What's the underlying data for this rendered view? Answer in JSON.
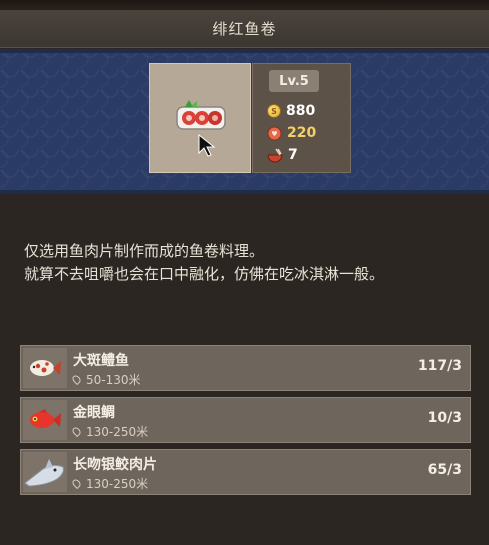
{
  "title": "绯红鱼卷",
  "item": {
    "level": "Lv.5",
    "price": "880",
    "hearts": "220",
    "servings": "7",
    "colors": {
      "hearts": "#f2d16b",
      "banner": "#2a3b66"
    }
  },
  "description": {
    "line1": "仅选用鱼肉片制作而成的鱼卷料理。",
    "line2": "就算不去咀嚼也会在口中融化，仿佛在吃冰淇淋一般。"
  },
  "ingredients": [
    {
      "name": "大斑鳢鱼",
      "range": "50-130米",
      "count": "117/3",
      "icon": "spotted-fish-icon"
    },
    {
      "name": "金眼鲷",
      "range": "130-250米",
      "count": "10/3",
      "icon": "red-fish-icon"
    },
    {
      "name": "长吻银鲛肉片",
      "range": "130-250米",
      "count": "65/3",
      "icon": "longnose-chimaera-icon"
    }
  ]
}
